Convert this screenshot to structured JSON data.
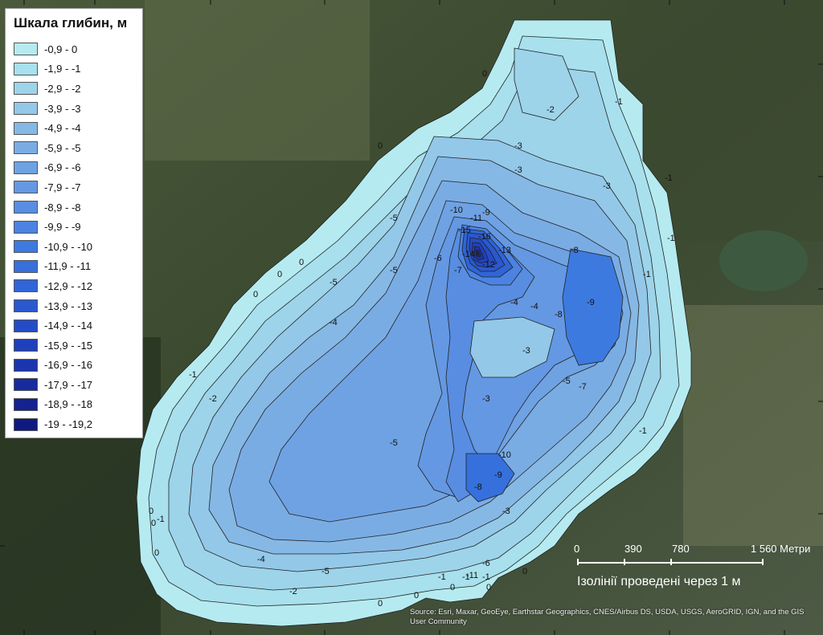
{
  "legend": {
    "title": "Шкала глибин, м",
    "items": [
      {
        "label": "-0,9 - 0",
        "color": "#b5ebf0"
      },
      {
        "label": "-1,9 - -1",
        "color": "#a8e0ed"
      },
      {
        "label": "-2,9 - -2",
        "color": "#9dd4ea"
      },
      {
        "label": "-3,9 - -3",
        "color": "#93c8e8"
      },
      {
        "label": "-4,9 - -4",
        "color": "#86b8e5"
      },
      {
        "label": "-5,9 - -5",
        "color": "#7aace4"
      },
      {
        "label": "-6,9 - -6",
        "color": "#6fa2e3"
      },
      {
        "label": "-7,9 - -7",
        "color": "#6498e3"
      },
      {
        "label": "-8,9 - -8",
        "color": "#588de2"
      },
      {
        "label": "-9,9 - -9",
        "color": "#4c83e2"
      },
      {
        "label": "-10,9 - -10",
        "color": "#3d7ae0"
      },
      {
        "label": "-11,9 - -11",
        "color": "#3670dc"
      },
      {
        "label": "-12,9 - -12",
        "color": "#2f65d6"
      },
      {
        "label": "-13,9 - -13",
        "color": "#2a58cf"
      },
      {
        "label": "-14,9 - -14",
        "color": "#244cc6"
      },
      {
        "label": "-15,9 - -15",
        "color": "#2040bb"
      },
      {
        "label": "-16,9 - -16",
        "color": "#1b35ae"
      },
      {
        "label": "-17,9 - -17",
        "color": "#172b9f"
      },
      {
        "label": "-18,9 - -18",
        "color": "#13228f"
      },
      {
        "label": "-19 - -19,2",
        "color": "#0f1a80"
      }
    ]
  },
  "scale_bar": {
    "ticks": [
      "0",
      "390",
      "780",
      "1 560 Метри"
    ],
    "caption": "Ізолінії проведені через 1 м"
  },
  "attribution": "Source: Esri, Maxar, GeoEye, Earthstar Geographics, CNES/Airbus DS, USDA, USGS, AeroGRID, IGN, and the GIS User Community",
  "contour_labels": [
    "0",
    "0",
    "0",
    "0",
    "0",
    "0",
    "0",
    "0",
    "0",
    "0",
    "0",
    "0",
    "0",
    "-1",
    "-1",
    "-1",
    "-1",
    "-1",
    "-1",
    "-1",
    "-1",
    "-1",
    "-1",
    "-2",
    "-2",
    "-2",
    "-3",
    "-3",
    "-3",
    "-3",
    "-3",
    "-3",
    "-4",
    "-4",
    "-4",
    "-4",
    "-5",
    "-5",
    "-5",
    "-5",
    "-5",
    "-5",
    "-6",
    "-6",
    "-7",
    "-7",
    "-8",
    "-8",
    "-8",
    "-9",
    "-9",
    "-9",
    "-10",
    "-10",
    "-11",
    "-11",
    "-12",
    "-13",
    "-14",
    "-15",
    "-16"
  ]
}
